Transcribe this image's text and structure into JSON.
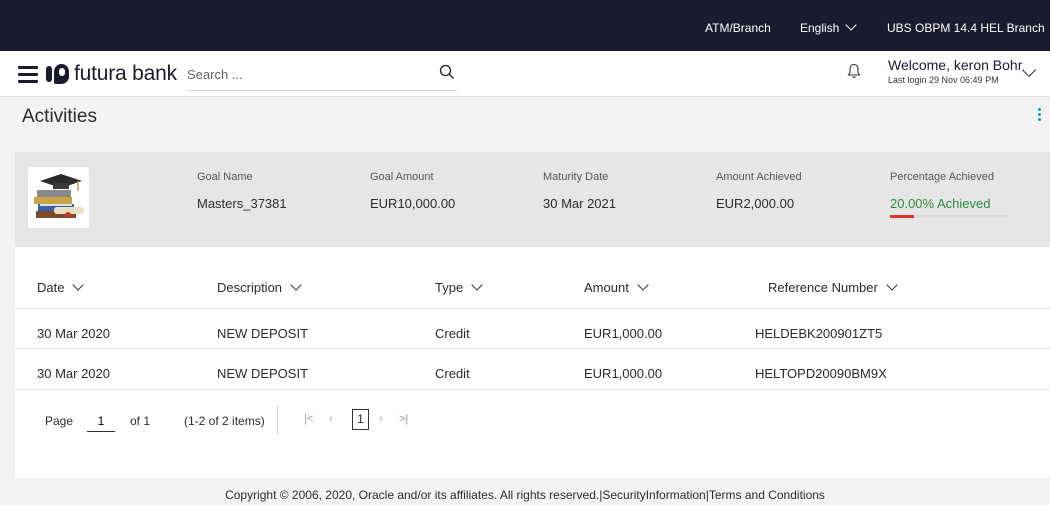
{
  "topbar": {
    "atm_branch": "ATM/Branch",
    "language": "English",
    "branch": "UBS OBPM 14.4 HEL Branch"
  },
  "header": {
    "brand": "futura bank",
    "search_placeholder": "Search ...",
    "welcome": "Welcome, keron Bohr",
    "last_login": "Last login 29 Nov 06:49 PM"
  },
  "page": {
    "title": "Activities"
  },
  "goal": {
    "name_label": "Goal Name",
    "name_value": "Masters_37381",
    "amount_label": "Goal Amount",
    "amount_value": "EUR10,000.00",
    "maturity_label": "Maturity Date",
    "maturity_value": "30 Mar 2021",
    "achieved_label": "Amount Achieved",
    "achieved_value": "EUR2,000.00",
    "percentage_label": "Percentage Achieved",
    "percentage_value": "20.00% Achieved",
    "progress_fraction": 0.2
  },
  "table": {
    "headers": [
      "Date",
      "Description",
      "Type",
      "Amount",
      "Reference Number"
    ],
    "rows": [
      [
        "30 Mar 2020",
        "NEW DEPOSIT",
        "Credit",
        "EUR1,000.00",
        "HELDEBK200901ZT5"
      ],
      [
        "30 Mar 2020",
        "NEW DEPOSIT",
        "Credit",
        "EUR1,000.00",
        "HELTOPD20090BM9X"
      ]
    ]
  },
  "pagination": {
    "page_label": "Page",
    "page_value": "1",
    "of_label": "of 1",
    "items_label": "(1-2 of 2 items)",
    "current_page": "1"
  },
  "footer": {
    "copyright": "Copyright © 2006, 2020, Oracle and/or its affiliates. All rights reserved.",
    "sep1": "|",
    "security": "SecurityInformation",
    "sep2": "|",
    "terms": "Terms and Conditions"
  },
  "colors": {
    "topbar": "#1b1b2f",
    "achieved_text": "#2a8a3a",
    "progress_fill": "#d9342b",
    "kebab": "#00a0c6"
  }
}
